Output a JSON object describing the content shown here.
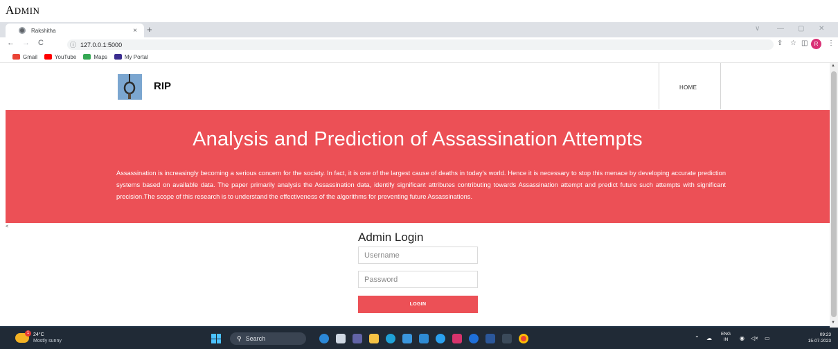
{
  "caption": {
    "first": "A",
    "rest": "DMIN"
  },
  "browser": {
    "tab_title": "Rakshitha",
    "tab_close": "×",
    "new_tab": "+",
    "url": "127.0.0.1:5000",
    "window_controls": [
      "∨",
      "—",
      "▢",
      "✕"
    ]
  },
  "bookmarks": [
    {
      "label": "Gmail",
      "color": "#ea4335"
    },
    {
      "label": "YouTube",
      "color": "#ff0000"
    },
    {
      "label": "Maps",
      "color": "#34a853"
    },
    {
      "label": "My Portal",
      "color": "#3b2d8f"
    }
  ],
  "profile_initial": "R",
  "site": {
    "brand": "RIP",
    "nav_home": "HOME",
    "hero_title": "Analysis and Prediction of Assassination Attempts",
    "hero_text": "Assassination is increasingly becoming a serious concern for the society. In fact, it is one of the largest cause of deaths in today's world. Hence it is necessary to stop this menace by developing accurate prediction systems based on available data. The paper primarily analysis the Assassination data, identify significant attributes contributing towards Assassination attempt and predict future such attempts with significant precision.The scope of this research is to understand the effectiveness of the algorithms for preventing future Assassinations.",
    "stray_mark": "<",
    "login": {
      "title": "Admin Login",
      "username_placeholder": "Username",
      "password_placeholder": "Password",
      "button": "LOGIN"
    }
  },
  "colors": {
    "accent": "#ec5056",
    "taskbar": "#202a36"
  },
  "taskbar": {
    "temperature": "24°C",
    "weather": "Mostly sunny",
    "weather_badge": "1",
    "search": "Search",
    "lang_top": "ENG",
    "lang_bottom": "IN",
    "time": "09:23",
    "date": "15-07-2023"
  }
}
